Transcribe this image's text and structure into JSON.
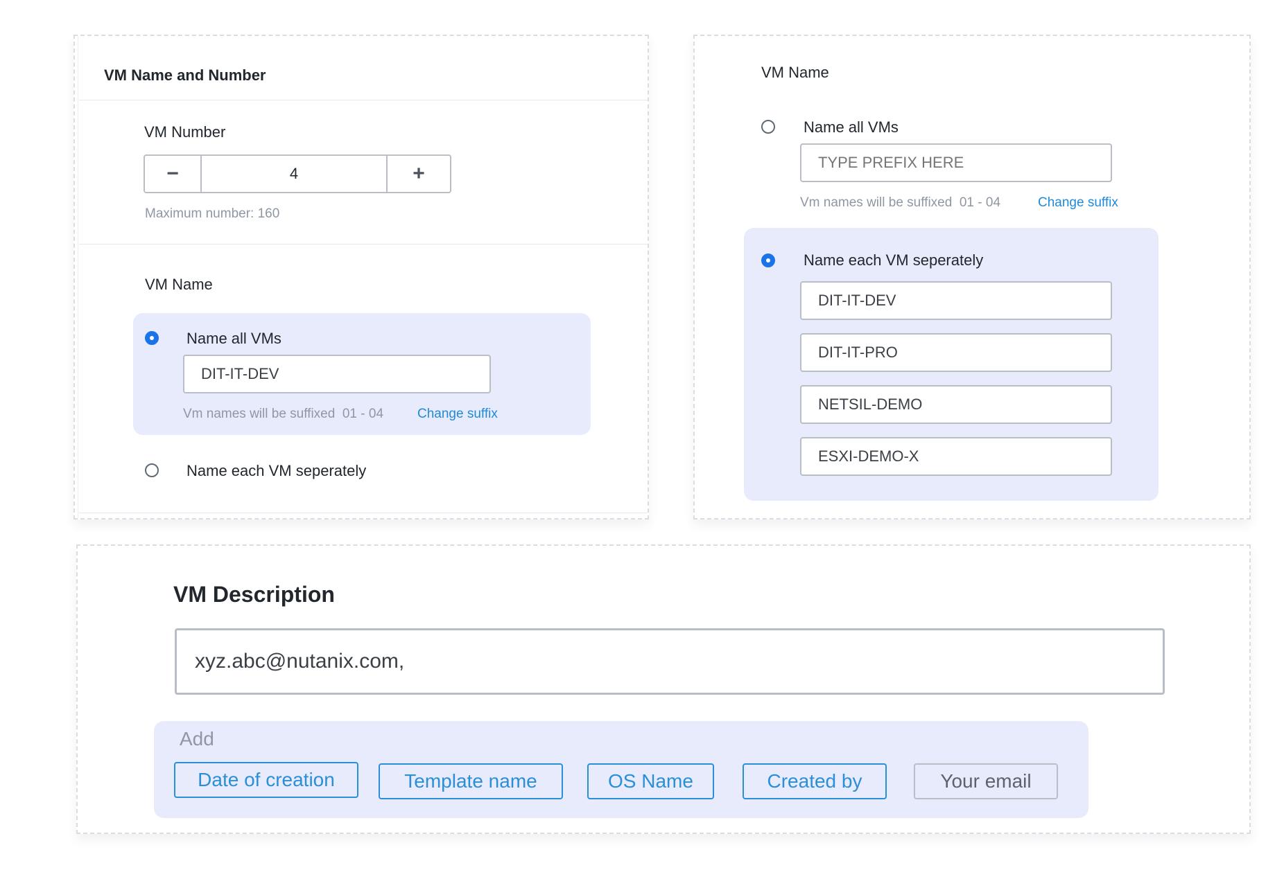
{
  "panel1": {
    "title": "VM Name and Number",
    "vm_number": {
      "label": "VM Number",
      "minus": "−",
      "value": "4",
      "plus": "+",
      "hint": "Maximum number: 160"
    },
    "vm_name": {
      "label": "VM Name",
      "option_all": "Name all VMs",
      "field_value": "DIT-IT-DEV",
      "suffix_hint": "Vm names will be suffixed  01 - 04",
      "change_suffix": "Change suffix",
      "option_each": "Name each VM seperately",
      "selected": "all"
    }
  },
  "panel2": {
    "title": "VM Name",
    "option_all": "Name all VMs",
    "prefix_placeholder": "TYPE PREFIX HERE",
    "suffix_hint": "Vm names will be suffixed  01 - 04",
    "change_suffix": "Change suffix",
    "option_each": "Name each VM seperately",
    "selected": "each",
    "names": [
      "DIT-IT-DEV",
      "DIT-IT-PRO",
      "NETSIL-DEMO",
      "ESXI-DEMO-X"
    ]
  },
  "panel3": {
    "title": "VM Description",
    "description_value": "xyz.abc@nutanix.com,",
    "add_label": "Add",
    "chips": [
      "Date of creation",
      "Template name",
      "OS Name",
      "Created by",
      "Your email"
    ]
  },
  "colors": {
    "accent": "#1b73e8",
    "link": "#1f8ad8",
    "highlight": "#e8ebfb",
    "border": "#b9bec6"
  },
  "icons": {
    "radio_selected": "radio-selected-icon",
    "radio_unselected": "radio-unselected-icon",
    "minus": "minus-icon",
    "plus": "plus-icon"
  }
}
